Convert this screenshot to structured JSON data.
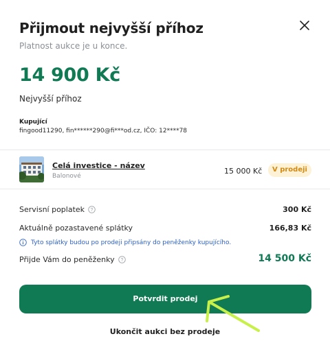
{
  "dialog": {
    "title": "Přijmout nejvyšší příhoz",
    "subtitle": "Platnost aukce je u konce.",
    "highest_bid_amount": "14 900 Kč",
    "highest_bid_label": "Nejvyšší příhoz",
    "buyer_label": "Kupující",
    "buyer_value": "fingood11290, fin******290@fi***od.cz, IČO: 12****78"
  },
  "item": {
    "name": "Celá investice - název",
    "location": "Balonové",
    "price": "15 000 Kč",
    "status_badge": "V prodeji",
    "thumbnail_icon": "building-photo"
  },
  "summary": {
    "service_fee_label": "Servisní poplatek",
    "service_fee_value": "300 Kč",
    "suspended_installments_label": "Aktuálně pozastavené splátky",
    "suspended_installments_value": "166,83 Kč",
    "note": "Tyto splátky budou po prodeji připsány do peněženky kupujícího.",
    "wallet_label": "Přijde Vám do peněženky",
    "wallet_value": "14 500 Kč"
  },
  "actions": {
    "confirm_label": "Potvrdit prodej",
    "end_auction_label": "Ukončit aukci bez prodeje"
  },
  "colors": {
    "brand_green": "#0f7a53",
    "badge_bg": "#fdf1d6",
    "badge_text": "#d38a12",
    "note_blue": "#2a5fc7",
    "annotation_arrow": "#c8f04a"
  }
}
